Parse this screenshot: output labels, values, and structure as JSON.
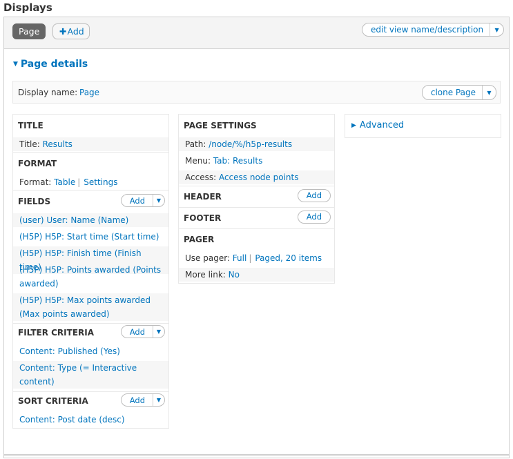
{
  "header": {
    "title": "Displays"
  },
  "tabs": {
    "page_label": "Page",
    "add_label": "Add"
  },
  "edit_view": {
    "label": "edit view name/description"
  },
  "page_details": {
    "label": "Page details"
  },
  "display_name": {
    "label": "Display name:",
    "value": "Page",
    "clone_label": "clone Page"
  },
  "column1": {
    "title": {
      "heading": "TITLE",
      "key": "Title:",
      "value": "Results"
    },
    "format": {
      "heading": "FORMAT",
      "key": "Format:",
      "value": "Table",
      "separator": "|",
      "settings": "Settings"
    },
    "fields": {
      "heading": "FIELDS",
      "add_label": "Add",
      "items": [
        "(user) User: Name (Name)",
        "(H5P) H5P: Start time (Start time)",
        "(H5P) H5P: Finish time (Finish time)",
        "(H5P) H5P: Points awarded (Points",
        "awarded)",
        "(H5P) H5P: Max points awarded",
        "(Max points awarded)"
      ]
    },
    "filter": {
      "heading": "FILTER CRITERIA",
      "add_label": "Add",
      "items": [
        "Content: Published (Yes)",
        "Content: Type (= Interactive",
        "content)"
      ]
    },
    "sort": {
      "heading": "SORT CRITERIA",
      "add_label": "Add",
      "items": [
        "Content: Post date (desc)"
      ]
    }
  },
  "column2": {
    "page_settings": {
      "heading": "PAGE SETTINGS",
      "path_key": "Path:",
      "path_value": "/node/%/h5p-results",
      "menu_key": "Menu:",
      "menu_value": "Tab: Results",
      "access_key": "Access:",
      "access_value": "Access node points"
    },
    "header": {
      "heading": "HEADER",
      "add_label": "Add"
    },
    "footer": {
      "heading": "FOOTER",
      "add_label": "Add"
    },
    "pager": {
      "heading": "PAGER",
      "use_pager_key": "Use pager:",
      "use_pager_value": "Full",
      "separator": "|",
      "paged_value": "Paged, 20 items",
      "more_link_key": "More link:",
      "more_link_value": "No"
    }
  },
  "column3": {
    "advanced_label": "Advanced"
  },
  "colors": {
    "link": "#0074bd",
    "active_tab": "#666666",
    "border": "#cfcfcf"
  }
}
